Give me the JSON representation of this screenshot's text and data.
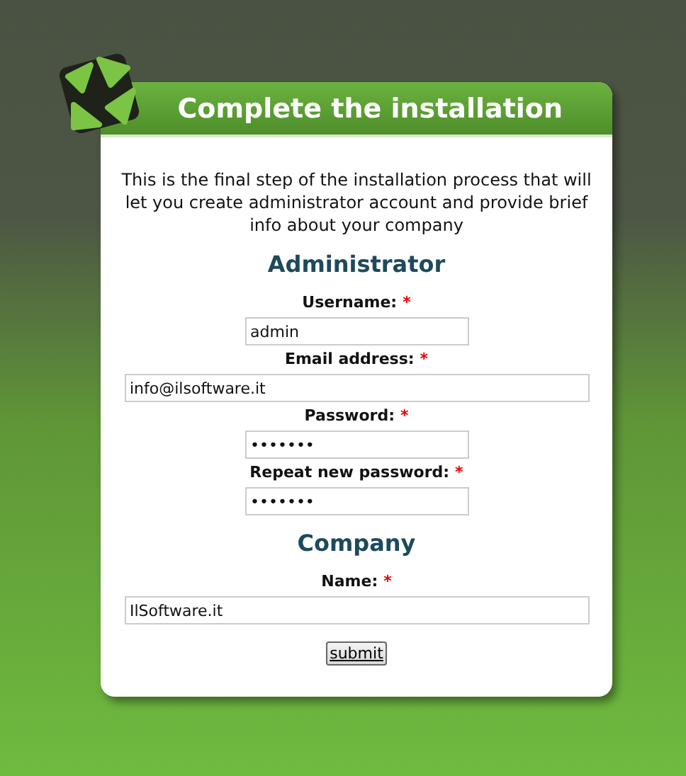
{
  "header": {
    "title": "Complete the installation"
  },
  "intro": "This is the final step of the installation process that will let you create administrator account and provide brief info about your company",
  "sections": [
    {
      "heading": "Administrator",
      "fields": [
        {
          "label": "Username:",
          "required_mark": "*",
          "value": "admin",
          "kind": "short"
        },
        {
          "label": "Email address:",
          "required_mark": "*",
          "value": "info@ilsoftware.it",
          "kind": "long"
        },
        {
          "label": "Password:",
          "required_mark": "*",
          "value": "•••••••",
          "kind": "short"
        },
        {
          "label": "Repeat new password:",
          "required_mark": "*",
          "value": "•••••••",
          "kind": "short"
        }
      ]
    },
    {
      "heading": "Company",
      "fields": [
        {
          "label": "Name:",
          "required_mark": "*",
          "value": "IlSoftware.it",
          "kind": "long"
        }
      ]
    }
  ],
  "submit": "submit"
}
